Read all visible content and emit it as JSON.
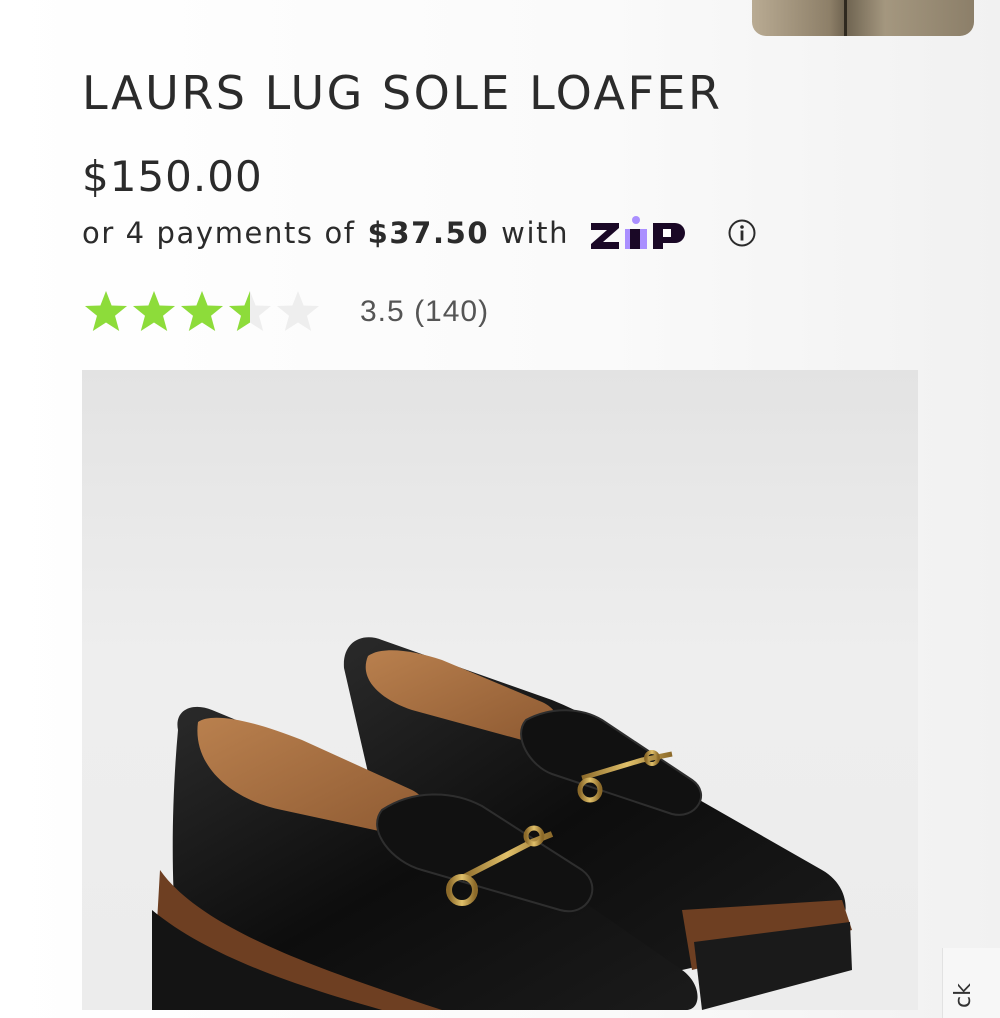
{
  "product": {
    "title": "LAURS LUG SOLE LOAFER",
    "price": "$150.00",
    "installments": {
      "prefix": "or 4 payments of",
      "amount": "$37.50",
      "suffix": "with",
      "provider": "zip",
      "info_icon": "info-icon"
    },
    "rating": {
      "value": 3.5,
      "max": 5,
      "display": "3.5",
      "count_label": "(140)",
      "star_color": "#8ddc3a",
      "empty_star_color": "#eeeeee"
    },
    "image": {
      "alt_icon": "black-loafer-pair-photo"
    }
  },
  "side_tab": {
    "label": "ck"
  },
  "colors": {
    "text": "#2b2b2b",
    "zip_brand": "#1a0826",
    "zip_accent": "#aa8fff"
  }
}
